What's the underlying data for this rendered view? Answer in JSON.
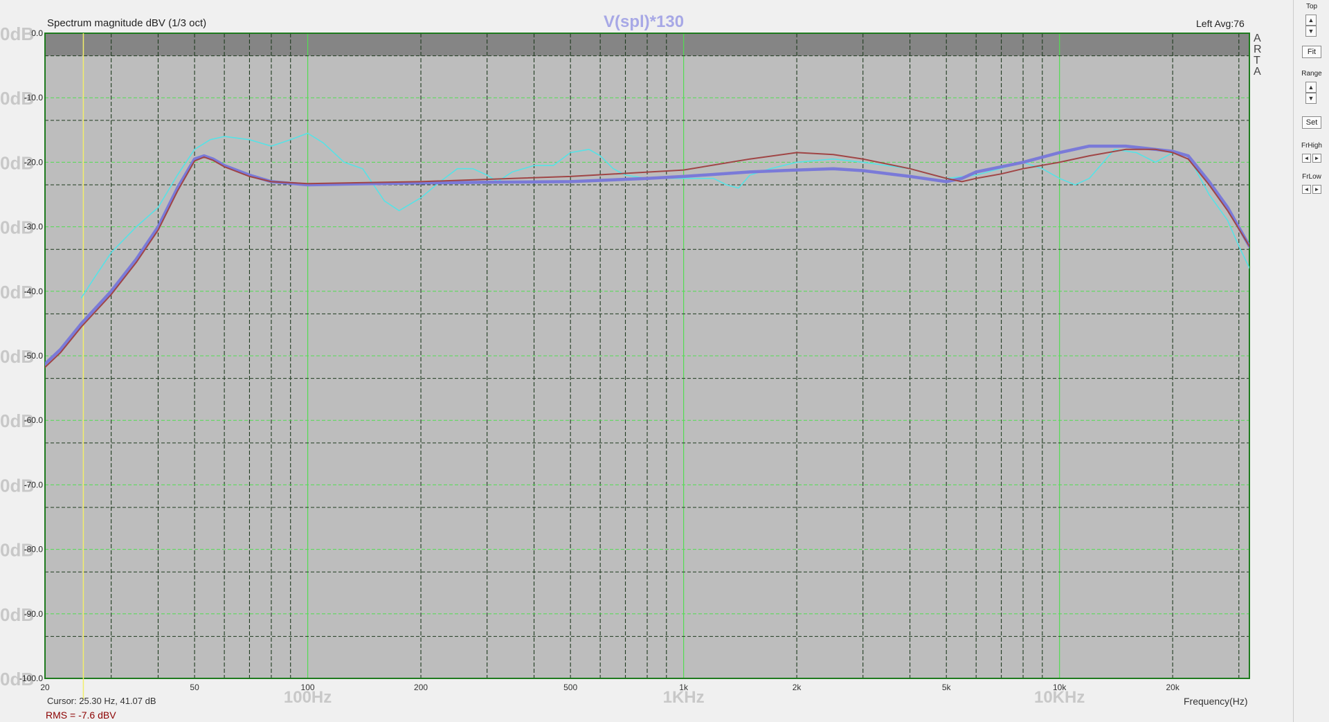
{
  "app": {
    "title": "Spectrum magnitude dBV (1/3 oct)",
    "subtitle": "V(spl)*130",
    "status": "Left   Avg:76",
    "arta": [
      "A",
      "R",
      "T",
      "A"
    ],
    "cursor_text": "Cursor:    25.30 Hz,  41.07 dB",
    "rms_text": "RMS =    -7.6 dBV",
    "xlabel": "Frequency(Hz)"
  },
  "sidebar": {
    "top_label": "Top",
    "fit_label": "Fit",
    "range_label": "Range",
    "set_label": "Set",
    "frhigh_label": "FrHigh",
    "frlow_label": "FrLow",
    "up_glyph": "▲",
    "down_glyph": "▼",
    "left_glyph": "◄",
    "right_glyph": "►"
  },
  "chart_data": {
    "type": "line",
    "x_scale": "log",
    "xlim": [
      20,
      32000
    ],
    "ylim": [
      -100,
      0
    ],
    "grid": true,
    "x_ticks": [
      {
        "value": 20,
        "label": "20"
      },
      {
        "value": 50,
        "label": "50"
      },
      {
        "value": 100,
        "label": "100"
      },
      {
        "value": 200,
        "label": "200"
      },
      {
        "value": 500,
        "label": "500"
      },
      {
        "value": 1000,
        "label": "1k"
      },
      {
        "value": 2000,
        "label": "2k"
      },
      {
        "value": 5000,
        "label": "5k"
      },
      {
        "value": 10000,
        "label": "10k"
      },
      {
        "value": 20000,
        "label": "20k"
      }
    ],
    "decade_labels": [
      {
        "value": 100,
        "label": "100Hz"
      },
      {
        "value": 1000,
        "label": "1KHz"
      },
      {
        "value": 10000,
        "label": "10KHz"
      }
    ],
    "y_ticks": [
      0,
      -10,
      -20,
      -30,
      -40,
      -50,
      -60,
      -70,
      -80,
      -90,
      -100
    ],
    "y_tick_labels": [
      "0.0",
      "-10.0",
      "-20.0",
      "-30.0",
      "-40.0",
      "-50.0",
      "-60.0",
      "-70.0",
      "-80.0",
      "-90.0",
      "-100.0"
    ],
    "y_ghost_label": "0dB",
    "top_band": [
      -3.5,
      0
    ],
    "cursor_x": 25.3,
    "colors": {
      "plot_bg": "#bdbdbd",
      "top_band": "#858585",
      "minor_grid": "#1f3a1f",
      "major_grid": "#52dd52",
      "frame": "#1e7a1e",
      "cursor": "#f2ee6a",
      "ghost_text": "#c8c8c8"
    },
    "series": [
      {
        "color": "#56e2e6",
        "width": 1.6,
        "points": [
          [
            25,
            -41
          ],
          [
            27,
            -38
          ],
          [
            30,
            -34
          ],
          [
            35,
            -30
          ],
          [
            40,
            -27
          ],
          [
            45,
            -22
          ],
          [
            50,
            -18
          ],
          [
            55,
            -16.5
          ],
          [
            60,
            -16
          ],
          [
            70,
            -16.5
          ],
          [
            80,
            -17.5
          ],
          [
            90,
            -16.5
          ],
          [
            100,
            -15.5
          ],
          [
            110,
            -17
          ],
          [
            125,
            -20
          ],
          [
            140,
            -21
          ],
          [
            160,
            -26
          ],
          [
            175,
            -27.5
          ],
          [
            200,
            -25.5
          ],
          [
            225,
            -23
          ],
          [
            250,
            -21
          ],
          [
            275,
            -21
          ],
          [
            300,
            -22
          ],
          [
            320,
            -23
          ],
          [
            350,
            -21.5
          ],
          [
            400,
            -20.5
          ],
          [
            450,
            -20.5
          ],
          [
            500,
            -18.5
          ],
          [
            560,
            -18
          ],
          [
            600,
            -19
          ],
          [
            650,
            -21
          ],
          [
            700,
            -22
          ],
          [
            800,
            -22.5
          ],
          [
            1000,
            -22.5
          ],
          [
            1200,
            -22.5
          ],
          [
            1300,
            -23.5
          ],
          [
            1400,
            -24
          ],
          [
            1500,
            -22
          ],
          [
            1700,
            -21
          ],
          [
            2000,
            -20
          ],
          [
            2500,
            -19.5
          ],
          [
            3000,
            -20
          ],
          [
            4000,
            -21
          ],
          [
            5000,
            -22.5
          ],
          [
            6000,
            -22
          ],
          [
            8000,
            -20
          ],
          [
            9000,
            -21
          ],
          [
            10000,
            -22.5
          ],
          [
            11000,
            -23.5
          ],
          [
            12000,
            -22.5
          ],
          [
            14000,
            -18
          ],
          [
            16000,
            -18.5
          ],
          [
            18000,
            -20
          ],
          [
            20000,
            -18.5
          ],
          [
            22000,
            -19
          ],
          [
            25000,
            -25
          ],
          [
            28000,
            -29
          ],
          [
            30000,
            -33
          ],
          [
            33000,
            -38
          ],
          [
            37000,
            -40
          ],
          [
            42000,
            -43
          ],
          [
            47000,
            -47
          ]
        ]
      },
      {
        "color": "#7a7ad8",
        "width": 4.5,
        "points": [
          [
            19,
            -52.5
          ],
          [
            22,
            -49
          ],
          [
            25,
            -45
          ],
          [
            30,
            -40
          ],
          [
            35,
            -35
          ],
          [
            40,
            -30
          ],
          [
            45,
            -24
          ],
          [
            50,
            -19.5
          ],
          [
            53,
            -19
          ],
          [
            56,
            -19.5
          ],
          [
            60,
            -20.5
          ],
          [
            70,
            -22
          ],
          [
            80,
            -23
          ],
          [
            100,
            -23.5
          ],
          [
            150,
            -23.3
          ],
          [
            200,
            -23.2
          ],
          [
            300,
            -23.1
          ],
          [
            500,
            -23
          ],
          [
            800,
            -22.5
          ],
          [
            1000,
            -22.2
          ],
          [
            1500,
            -21.5
          ],
          [
            2000,
            -21.2
          ],
          [
            2500,
            -21
          ],
          [
            3000,
            -21.3
          ],
          [
            4000,
            -22.2
          ],
          [
            5000,
            -23
          ],
          [
            5500,
            -22.5
          ],
          [
            6000,
            -21.5
          ],
          [
            8000,
            -20
          ],
          [
            10000,
            -18.5
          ],
          [
            12000,
            -17.5
          ],
          [
            15000,
            -17.5
          ],
          [
            18000,
            -18
          ],
          [
            20000,
            -18.3
          ],
          [
            22000,
            -19
          ],
          [
            25000,
            -23
          ],
          [
            28000,
            -27
          ],
          [
            32000,
            -33
          ],
          [
            38000,
            -38
          ],
          [
            47000,
            -42
          ]
        ]
      },
      {
        "color": "#a04545",
        "width": 2,
        "points": [
          [
            19,
            -53
          ],
          [
            22,
            -49.5
          ],
          [
            25,
            -45.5
          ],
          [
            30,
            -40.5
          ],
          [
            35,
            -35.5
          ],
          [
            40,
            -30.5
          ],
          [
            45,
            -24.5
          ],
          [
            50,
            -19.8
          ],
          [
            53,
            -19.2
          ],
          [
            56,
            -19.7
          ],
          [
            60,
            -20.7
          ],
          [
            70,
            -22.2
          ],
          [
            80,
            -23
          ],
          [
            100,
            -23.3
          ],
          [
            200,
            -23
          ],
          [
            500,
            -22.2
          ],
          [
            1000,
            -21.2
          ],
          [
            1500,
            -19.5
          ],
          [
            2000,
            -18.5
          ],
          [
            2500,
            -18.8
          ],
          [
            3000,
            -19.5
          ],
          [
            4000,
            -21
          ],
          [
            5000,
            -22.5
          ],
          [
            5500,
            -23
          ],
          [
            6000,
            -22.5
          ],
          [
            7000,
            -21.8
          ],
          [
            8000,
            -21
          ],
          [
            10000,
            -20
          ],
          [
            12000,
            -19
          ],
          [
            15000,
            -18
          ],
          [
            18000,
            -18
          ],
          [
            20000,
            -18.5
          ],
          [
            22000,
            -19.5
          ],
          [
            25000,
            -23.5
          ],
          [
            28000,
            -27.5
          ],
          [
            32000,
            -33
          ],
          [
            38000,
            -38
          ],
          [
            47000,
            -42
          ]
        ]
      }
    ]
  }
}
